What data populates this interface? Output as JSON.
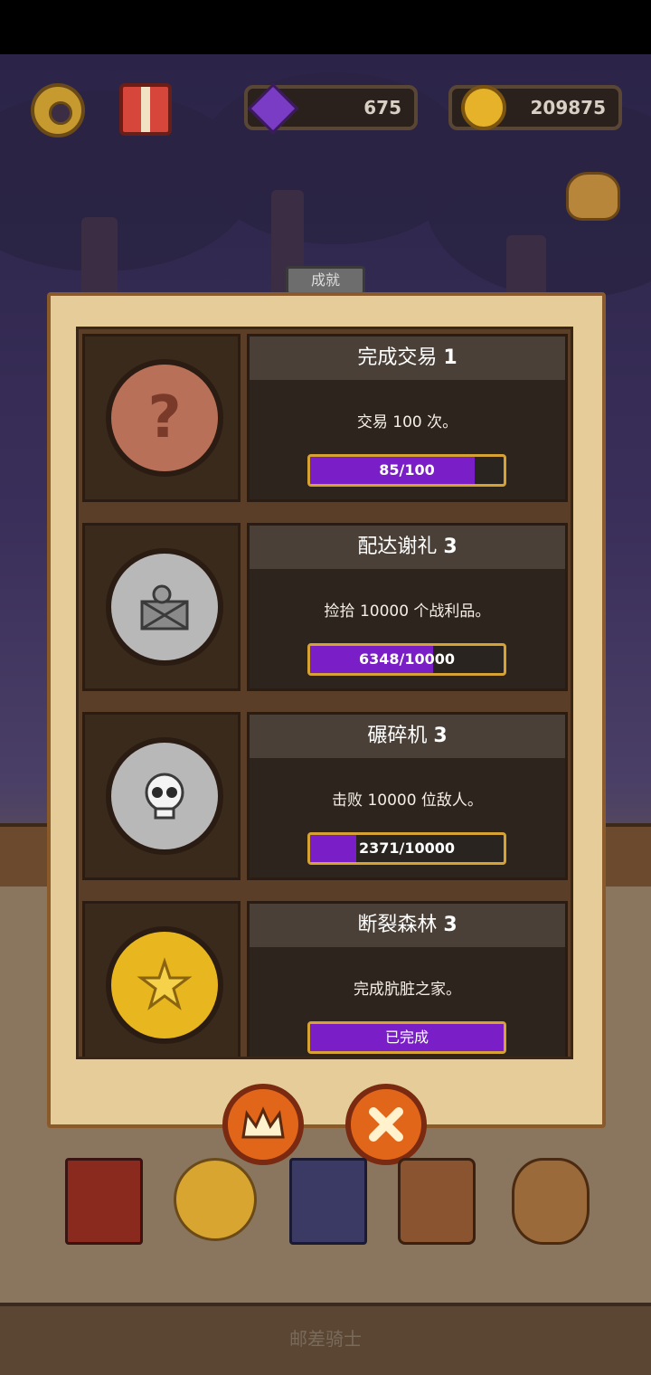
{
  "resources": {
    "gems": "675",
    "coins": "209875"
  },
  "dialog": {
    "tab_label": "成就"
  },
  "achievements": [
    {
      "title": "完成交易",
      "level": "1",
      "description": "交易 100 次。",
      "progress_text": "85/100",
      "progress_fraction": 0.85,
      "medal": "bronze-question-medal"
    },
    {
      "title": "配达谢礼",
      "level": "3",
      "description": "捡拾 10000 个战利品。",
      "progress_text": "6348/10000",
      "progress_fraction": 0.6348,
      "medal": "silver-loot-medal"
    },
    {
      "title": "碾碎机",
      "level": "3",
      "description": "击败 10000 位敌人。",
      "progress_text": "2371/10000",
      "progress_fraction": 0.2371,
      "medal": "silver-skull-medal"
    },
    {
      "title": "断裂森林",
      "level": "3",
      "description": "完成肮脏之家。",
      "progress_text": "已完成",
      "progress_fraction": 1.0,
      "medal": "gold-forest-medal"
    }
  ],
  "buttons": {
    "crown_icon": "crown-icon",
    "close_icon": "close-icon"
  },
  "bottom_nav": [
    "book-icon",
    "star-medal-icon",
    "card-deck-icon",
    "backpack-icon",
    "gold-bag-icon"
  ],
  "footer": {
    "title": "邮差骑士"
  },
  "colors": {
    "progress_fill": "#7a1fc8",
    "progress_border": "#d6a234",
    "button_orange": "#e2661a"
  }
}
